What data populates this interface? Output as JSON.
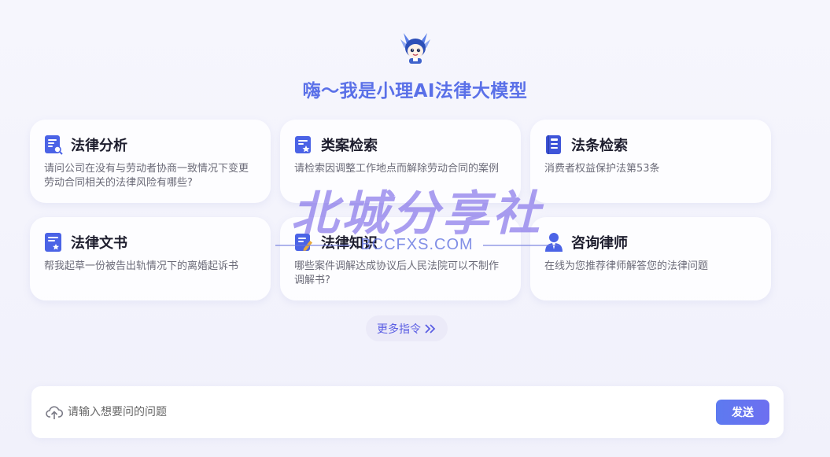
{
  "header": {
    "logo_icon": "cartoon-mascot-logo",
    "greeting": "嗨～我是小理AI法律大模型"
  },
  "cards": [
    {
      "icon": "legal-analysis-icon",
      "title": "法律分析",
      "desc": "请问公司在没有与劳动者协商一致情况下变更劳动合同相关的法律风险有哪些?"
    },
    {
      "icon": "case-search-icon",
      "title": "类案检索",
      "desc": "请检索因调整工作地点而解除劳动合同的案例"
    },
    {
      "icon": "statute-search-icon",
      "title": "法条检索",
      "desc": "消费者权益保护法第53条"
    },
    {
      "icon": "legal-document-icon",
      "title": "法律文书",
      "desc": "帮我起草一份被告出轨情况下的离婚起诉书"
    },
    {
      "icon": "legal-knowledge-icon",
      "title": "法律知识",
      "desc": "哪些案件调解达成协议后人民法院可以不制作调解书?"
    },
    {
      "icon": "consult-lawyer-icon",
      "title": "咨询律师",
      "desc": "在线为您推荐律师解答您的法律问题"
    }
  ],
  "more": {
    "label": "更多指令",
    "icon": "double-chevron-right-icon"
  },
  "input": {
    "placeholder": "请输入想要问的问题",
    "value": "",
    "upload_icon": "cloud-upload-icon"
  },
  "send": {
    "label": "发送"
  },
  "watermark": {
    "main": "北城分享社",
    "sub": "BCCFXS.COM"
  },
  "colors": {
    "accent": "#5a70e8",
    "button": "#6075ef",
    "more_text": "#5b5ee3"
  }
}
